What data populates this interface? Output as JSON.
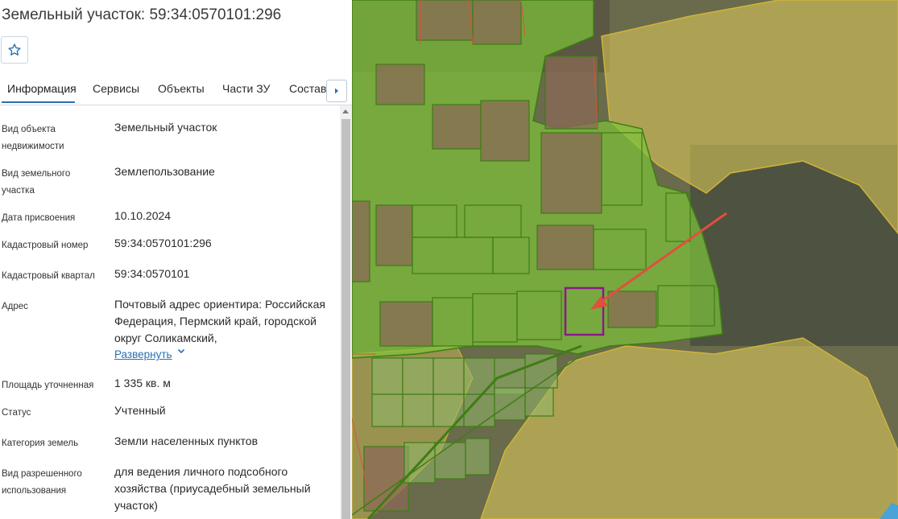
{
  "title": "Земельный участок: 59:34:0570101:296",
  "favorite_icon": "star-icon",
  "tabs": [
    {
      "label": "Информация"
    },
    {
      "label": "Сервисы"
    },
    {
      "label": "Объекты"
    },
    {
      "label": "Части ЗУ"
    },
    {
      "label": "Состав"
    }
  ],
  "tab_next_icon": "chevron-right-icon",
  "info": {
    "object_type_label": "Вид объекта недвижимости",
    "object_type_value": "Земельный участок",
    "parcel_type_label": "Вид земельного участка",
    "parcel_type_value": "Землепользование",
    "date_label": "Дата присвоения",
    "date_value": "10.10.2024",
    "cadastral_number_label": "Кадастровый номер",
    "cadastral_number_value": "59:34:0570101:296",
    "cadastral_block_label": "Кадастровый квартал",
    "cadastral_block_value": "59:34:0570101",
    "address_label": "Адрес",
    "address_value": "Почтовый адрес ориентира: Российская Федерация, Пермский край, городской округ Соликамский,",
    "expand_label": "Развернуть",
    "area_label": "Площадь уточненная",
    "area_value": "1 335 кв. м",
    "status_label": "Статус",
    "status_value": "Учтенный",
    "category_label": "Категория земель",
    "category_value": "Земли населенных пунктов",
    "permitted_use_label": "Вид разрешенного использования",
    "permitted_use_value": "для ведения личного подсобного хозяйства (приусадебный земельный участок)"
  },
  "colors": {
    "accent": "#2a6fb0",
    "parcel_fill": "#7ec43a",
    "parcel_stroke": "#3f7d14",
    "zone_fill": "#e3cf5a",
    "selected_parcel": "#8b1a8b",
    "pointer_arrow": "#e0503c"
  }
}
